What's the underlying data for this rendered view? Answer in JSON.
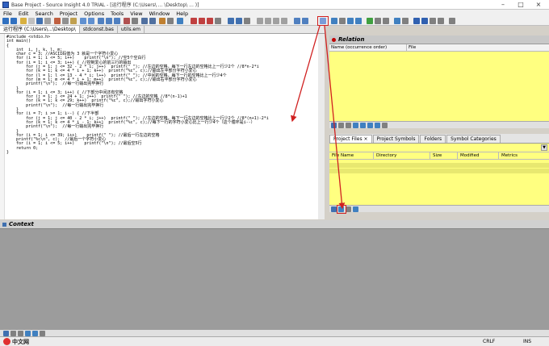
{
  "window": {
    "title": "Base Project - Source Insight 4.0 TRIAL - [运行程序 (C:\\Users\\ ... \\Desktop\\ ... )]",
    "controls": [
      "–",
      "□",
      "×"
    ]
  },
  "menu": [
    "File",
    "Edit",
    "Search",
    "Project",
    "Options",
    "Tools",
    "View",
    "Window",
    "Help"
  ],
  "tabs": [
    "运行程序 (C:\\Users\\...\\Desktop\\",
    "stdconst.bas",
    "utils.em"
  ],
  "editor": {
    "code_lines": [
      "#include <stdio.h>",
      "int main()",
      "{",
      "    int  i, j, k, l, m;",
      "    char c = 3; //ASCII码值为 3 就是一个字符小爱心",
      "    for (i = 1; i <= 5; i++)    printf(\"\\n\"); //空5个空白行",
      "    for (i = 1; i <= 3; i++) { //控制爱心的前三行的输出",
      "        for (j = 1; j <= 32 - 2 * i; j++)  printf(\" \"); //左边的空格，每下一行左边的空格比上一行少2个 //8*n-2*i",
      "        for (k = 1; k <= 4 * i + 1; k++)  printf(\"%c\", c);//输出左半部分字符小爱心",
      "        for (l = 1; l <= 13 - 4 * i; l++)  printf(\" \"); //中间的空格，每下一行的空格比上一行少4个",
      "        for (m = 1; m <= 4 * i + 1; m++)  printf(\"%c\", c);//输出右半部分字符小爱心",
      "        printf(\"\\n\");  //每一行输出完毕换行",
      "    }",
      "    for (i = 1; i <= 3; i++) { //下部分中间还有空格",
      "        for (j = 1; j <= 24 + 1; j++)  printf(\" \"); //左边的空格 //8*(n-1)+1",
      "        for (k = 1; k <= 29; k++)  printf(\"%c\", c);//输出字符小爱心",
      "        printf(\"\\n\");  //每一行输出完毕换行",
      "    }",
      "    for (i = 7; i >= 1; i--) { //下半部",
      "        for (j = 1; j <= 40 - 2 * i; j++)  printf(\" \"); //左边的空格，每下一行左边的空格比上一行少2个 //8*(n+1)-2*i",
      "        for (k = 1; k <= 4 * i - 1; k++)  printf(\"%c\", c);//每下一行的字符小爱心比上一行少4个（这个循环是i--）",
      "        printf(\"\\n\");  //每一行输出完毕换行",
      "    }",
      "    for (i = 1; i <= 39; i++)    printf(\" \"); //最后一行左边的空格",
      "    printf(\"%c\\n\", c);  //最后一个字符小爱心",
      "    for (i = 1; i <= 5; i++)    printf(\"\\n\"); //最后空5行",
      "    return 0;",
      "}"
    ]
  },
  "relation": {
    "title": "Relation",
    "columns": [
      "Name (occurrence order)",
      "File"
    ]
  },
  "project_files": {
    "tabs": [
      "Project Files",
      "×",
      "Project Symbols",
      "Folders",
      "Symbol Categories"
    ],
    "columns": [
      "File Name",
      "Directory",
      "Size",
      "Modified",
      "Metrics"
    ]
  },
  "context": {
    "title": "Context"
  },
  "status": {
    "left": "",
    "crlf": "CRLF",
    "ins": "INS"
  },
  "watermark": "中文网",
  "colors": {
    "panel_yellow": "#ffff80",
    "annotation_red": "#d02020"
  }
}
